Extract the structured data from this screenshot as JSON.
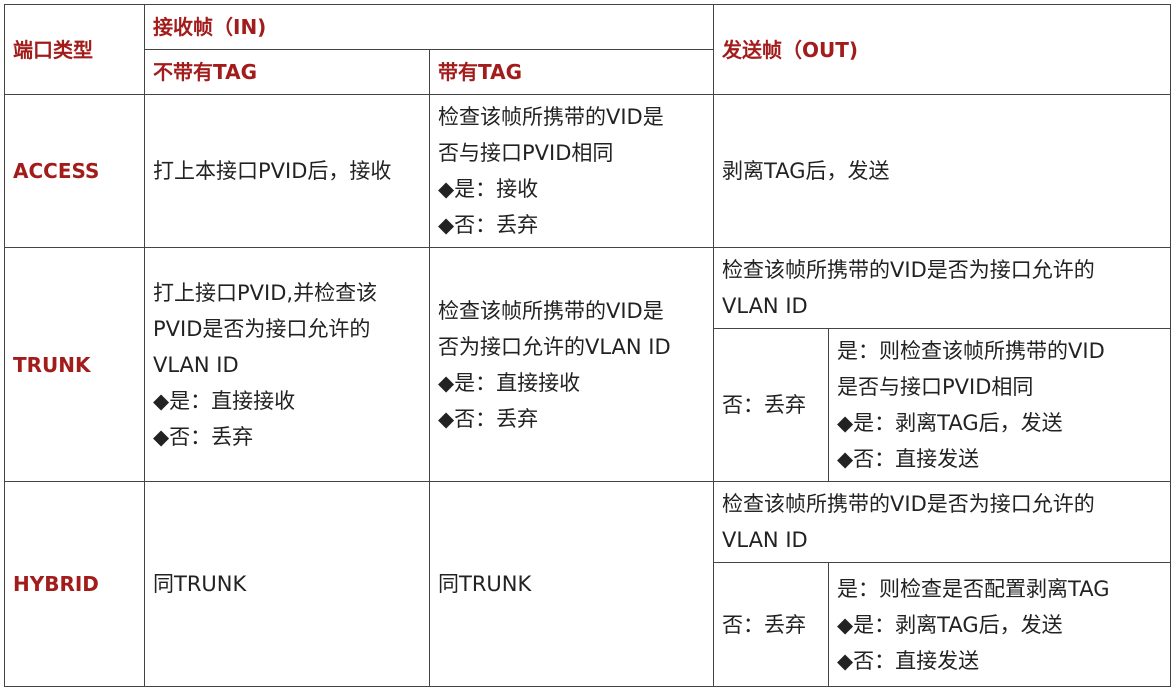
{
  "header": {
    "port_type": "端口类型",
    "receive": "接收帧（IN)",
    "untagged": "不带有TAG",
    "tagged": "带有TAG",
    "send": "发送帧（OUT)"
  },
  "access": {
    "label": "ACCESS",
    "in_untagged": "打上本接口PVID后，接收",
    "in_tagged": [
      "检查该帧所携带的VID是",
      "否与接口PVID相同",
      "◆是：接收",
      "◆否：丢弃"
    ],
    "out": "剥离TAG后，发送"
  },
  "trunk": {
    "label": "TRUNK",
    "in_untagged": [
      "打上接口PVID,并检查该",
      "PVID是否为接口允许的",
      "VLAN ID",
      "◆是：直接接收",
      "◆否：丢弃"
    ],
    "in_tagged": [
      "检查该帧所携带的VID是",
      "否为接口允许的VLAN ID",
      "◆是：直接接收",
      "◆否：丢弃"
    ],
    "out_check": [
      "检查该帧所携带的VID是否为接口允许的",
      "VLAN ID"
    ],
    "out_no": "否：丢弃",
    "out_yes": [
      "是：则检查该帧所携带的VID",
      "是否与接口PVID相同",
      "◆是：剥离TAG后，发送",
      "◆否：直接发送"
    ]
  },
  "hybrid": {
    "label": "HYBRID",
    "in_untagged": "同TRUNK",
    "in_tagged": "同TRUNK",
    "out_check": [
      "检查该帧所携带的VID是否为接口允许的",
      "VLAN ID"
    ],
    "out_no": "否：丢弃",
    "out_yes": [
      "是：则检查是否配置剥离TAG",
      "◆是：剥离TAG后，发送",
      "◆否：直接发送"
    ]
  }
}
